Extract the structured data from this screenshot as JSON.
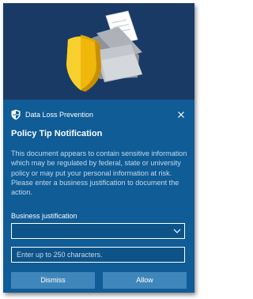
{
  "header": {
    "app_name": "Data Loss Prevention",
    "app_icon": "shield-icon",
    "close_icon": "close-icon"
  },
  "notification": {
    "title": "Policy Tip Notification",
    "message": "This document appears to contain sensitive information which may be regulated by federal, state or university policy or may put your personal information at risk.  Please enter a business justification to document the action."
  },
  "form": {
    "justification_label": "Business justification",
    "justification_selected": "",
    "comment_placeholder": "Enter up to 250 characters.",
    "comment_value": ""
  },
  "buttons": {
    "dismiss_label": "Dismiss",
    "allow_label": "Allow"
  },
  "colors": {
    "hero_background": "#1a3a66",
    "panel_background": "#0f5c96",
    "button_background": "#3f86bb",
    "shield_yellow": "#f5c518"
  }
}
